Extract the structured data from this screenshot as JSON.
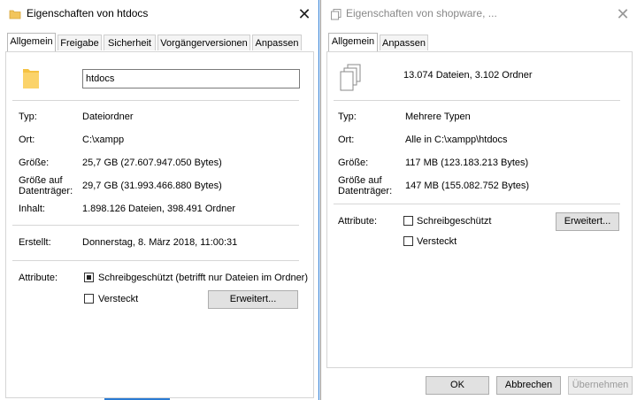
{
  "dialog_left": {
    "title": "Eigenschaften von htdocs",
    "tabs": [
      "Allgemein",
      "Freigabe",
      "Sicherheit",
      "Vorgängerversionen",
      "Anpassen"
    ],
    "folder_icon": "folder-icon",
    "name_value": "htdocs",
    "rows": {
      "typ": {
        "label": "Typ:",
        "value": "Dateiordner"
      },
      "ort": {
        "label": "Ort:",
        "value": "C:\\xampp"
      },
      "groesse": {
        "label": "Größe:",
        "value": "25,7 GB (27.607.947.050 Bytes)"
      },
      "datentraeger": {
        "label": "Größe auf\nDatenträger:",
        "label1": "Größe auf",
        "label2": "Datenträger:",
        "value": "29,7 GB (31.993.466.880 Bytes)"
      },
      "inhalt": {
        "label": "Inhalt:",
        "value": "1.898.126 Dateien, 398.491 Ordner"
      },
      "erstellt": {
        "label": "Erstellt:",
        "value": "Donnerstag, 8. März 2018, 11:00:31"
      }
    },
    "attributes": {
      "label": "Attribute:",
      "readonly": {
        "label": "Schreibgeschützt (betrifft nur Dateien im Ordner)",
        "checked": true
      },
      "hidden": {
        "label": "Versteckt",
        "checked": false
      },
      "advanced_button": "Erweitert..."
    }
  },
  "dialog_right": {
    "title": "Eigenschaften von shopware, ...",
    "tabs": [
      "Allgemein",
      "Anpassen"
    ],
    "files_icon": "multiple-files-icon",
    "summary": "13.074 Dateien, 3.102 Ordner",
    "rows": {
      "typ": {
        "label": "Typ:",
        "value": "Mehrere Typen"
      },
      "ort": {
        "label": "Ort:",
        "value": "Alle in C:\\xampp\\htdocs"
      },
      "groesse": {
        "label": "Größe:",
        "value": "117 MB (123.183.213 Bytes)"
      },
      "datentraeger": {
        "label1": "Größe auf",
        "label2": "Datenträger:",
        "value": "147 MB (155.082.752 Bytes)"
      }
    },
    "attributes": {
      "label": "Attribute:",
      "readonly": {
        "label": "Schreibgeschützt",
        "checked": false
      },
      "hidden": {
        "label": "Versteckt",
        "checked": false
      },
      "advanced_button": "Erweitert..."
    },
    "buttons": {
      "ok": "OK",
      "cancel": "Abbrechen",
      "apply": "Übernehmen"
    }
  }
}
